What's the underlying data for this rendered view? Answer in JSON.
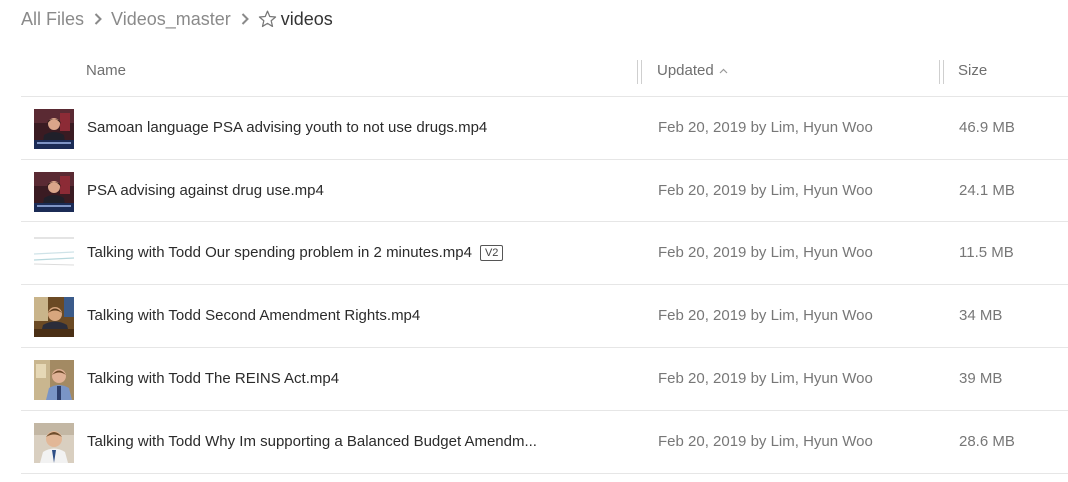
{
  "breadcrumb": {
    "items": [
      "All Files",
      "Videos_master"
    ],
    "current": "videos"
  },
  "columns": {
    "name": "Name",
    "updated": "Updated",
    "size": "Size"
  },
  "files": [
    {
      "name": "Samoan language PSA advising youth to not use drugs.mp4",
      "version": "",
      "updated": "Feb 20, 2019 by Lim, Hyun Woo",
      "size": "46.9 MB",
      "thumbnail": "video-podium-thumbnail"
    },
    {
      "name": "PSA advising against drug use.mp4",
      "version": "",
      "updated": "Feb 20, 2019 by Lim, Hyun Woo",
      "size": "24.1 MB",
      "thumbnail": "video-podium-thumbnail"
    },
    {
      "name": "Talking with Todd Our spending problem in 2 minutes.mp4",
      "version": "V2",
      "updated": "Feb 20, 2019 by Lim, Hyun Woo",
      "size": "11.5 MB",
      "thumbnail": "video-chart-thumbnail"
    },
    {
      "name": "Talking with Todd Second Amendment Rights.mp4",
      "version": "",
      "updated": "Feb 20, 2019 by Lim, Hyun Woo",
      "size": "34 MB",
      "thumbnail": "video-office-thumbnail"
    },
    {
      "name": "Talking with Todd The REINS Act.mp4",
      "version": "",
      "updated": "Feb 20, 2019 by Lim, Hyun Woo",
      "size": "39 MB",
      "thumbnail": "video-office-thumbnail"
    },
    {
      "name": "Talking with Todd Why Im supporting a Balanced Budget Amendm...",
      "version": "",
      "updated": "Feb 20, 2019 by Lim, Hyun Woo",
      "size": "28.6 MB",
      "thumbnail": "video-speaker-thumbnail"
    }
  ],
  "colors": {
    "breadcrumb_link": "#8a8a8a",
    "row_border": "#e6e6e6",
    "secondary_text": "#777777"
  }
}
